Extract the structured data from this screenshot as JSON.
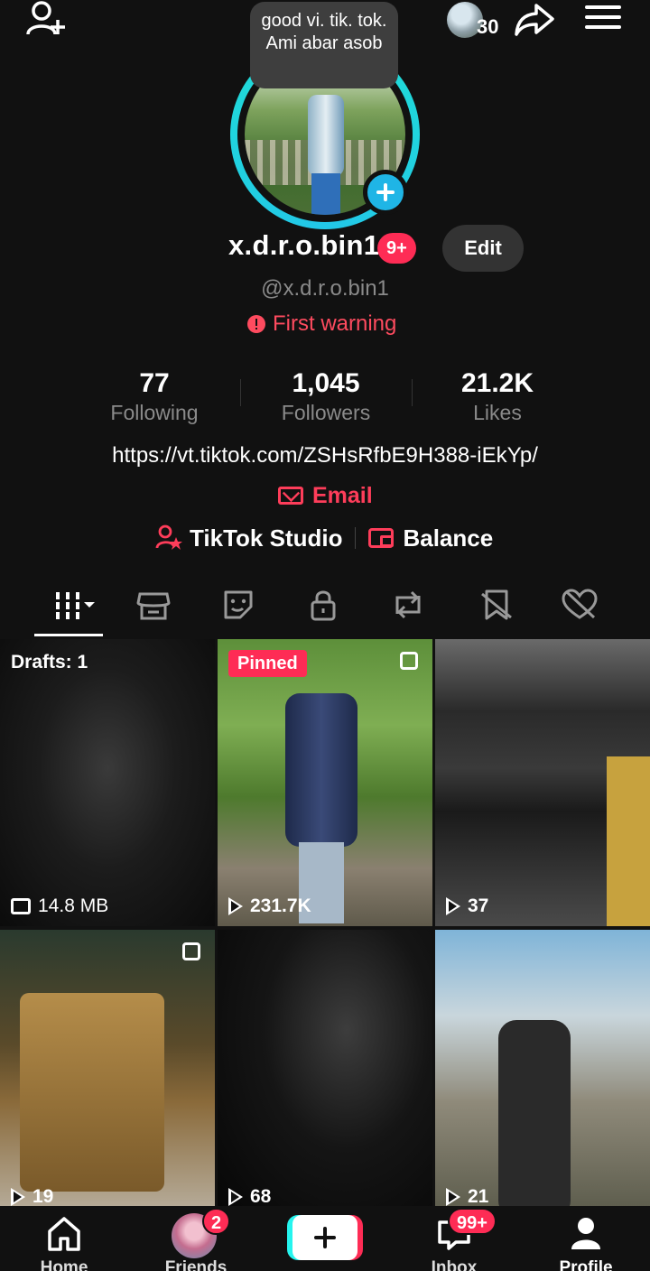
{
  "top": {
    "coin_count": "30",
    "bubble_text": "good vi.  tik. tok.  Ami abar asob"
  },
  "profile": {
    "username": "x.d.r.o.bin1",
    "notification_badge": "9+",
    "edit_label": "Edit",
    "handle": "@x.d.r.o.bin1",
    "warning": "First warning",
    "stats": [
      {
        "value": "77",
        "label": "Following"
      },
      {
        "value": "1,045",
        "label": "Followers"
      },
      {
        "value": "21.2K",
        "label": "Likes"
      }
    ],
    "link": "https://vt.tiktok.com/ZSHsRfbE9H388-iEkYp/",
    "email_label": "Email",
    "studio_label": "TikTok Studio",
    "balance_label": "Balance"
  },
  "tabs": [
    "videos-icon",
    "shop-icon",
    "sticker-icon",
    "lock-icon",
    "repost-icon",
    "favorites-icon",
    "liked-icon"
  ],
  "grid": {
    "drafts_label": "Drafts: 1",
    "drafts_size": "14.8 MB",
    "pinned_label": "Pinned",
    "views": [
      "231.7K",
      "37",
      "19",
      "68",
      "21"
    ]
  },
  "nav": {
    "home": "Home",
    "friends": "Friends",
    "friends_badge": "2",
    "inbox": "Inbox",
    "inbox_badge": "99+",
    "profile": "Profile"
  },
  "colors": {
    "accent": "#fe2c55",
    "teal": "#25f4ee",
    "background": "#111111"
  }
}
